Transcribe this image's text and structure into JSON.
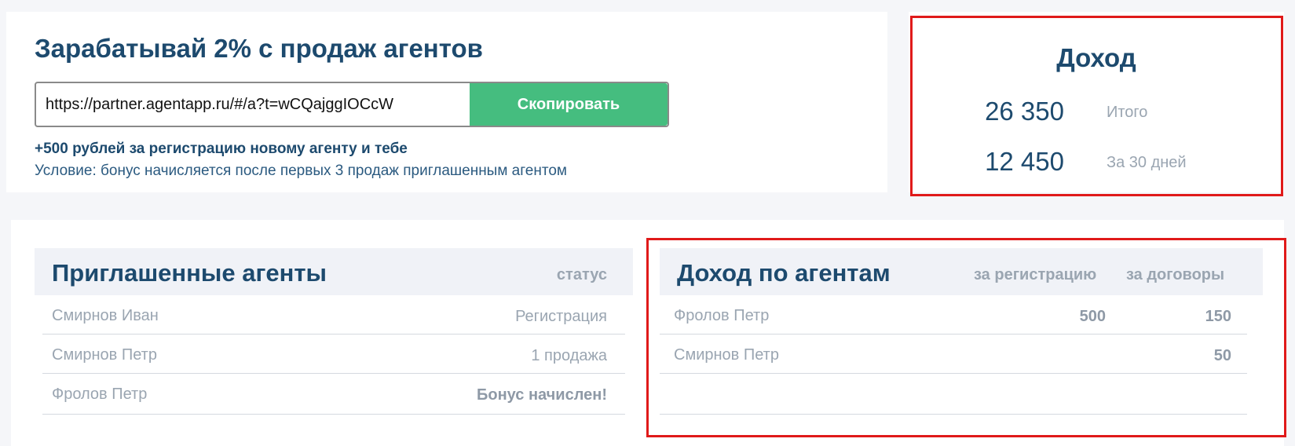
{
  "referral": {
    "title": "Зарабатывай 2% с продаж агентов",
    "link": "https://partner.agentapp.ru/#/a?t=wCQajggIOCcW",
    "copy_label": "Скопировать",
    "bonus": "+500 рублей за регистрацию новому агенту и тебе",
    "condition": "Условие: бонус начисляется после первых 3 продаж приглашенным агентом"
  },
  "income": {
    "title": "Доход",
    "rows": [
      {
        "value": "26 350",
        "label": "Итого"
      },
      {
        "value": "12 450",
        "label": "За 30 дней"
      }
    ]
  },
  "invited_agents": {
    "title": "Приглашенные агенты",
    "status_header": "статус",
    "rows": [
      {
        "name": "Смирнов Иван",
        "status": "Регистрация"
      },
      {
        "name": "Смирнов Петр",
        "status": "1 продажа"
      },
      {
        "name": "Фролов Петр",
        "status": "Бонус начислен!"
      }
    ]
  },
  "income_by_agents": {
    "title": "Доход по агентам",
    "col_registration": "за регистрацию",
    "col_contracts": "за договоры",
    "rows": [
      {
        "name": "Фролов Петр",
        "registration": "500",
        "contracts": "150"
      },
      {
        "name": "Смирнов Петр",
        "registration": "",
        "contracts": "50"
      },
      {
        "name": "",
        "registration": "",
        "contracts": ""
      }
    ]
  },
  "colors": {
    "primary_text": "#1d4a6e",
    "muted_text": "#9aa5b1",
    "copy_button": "#45bd7f",
    "highlight_border": "#e01a1a",
    "page_background": "#f5f6f9"
  }
}
